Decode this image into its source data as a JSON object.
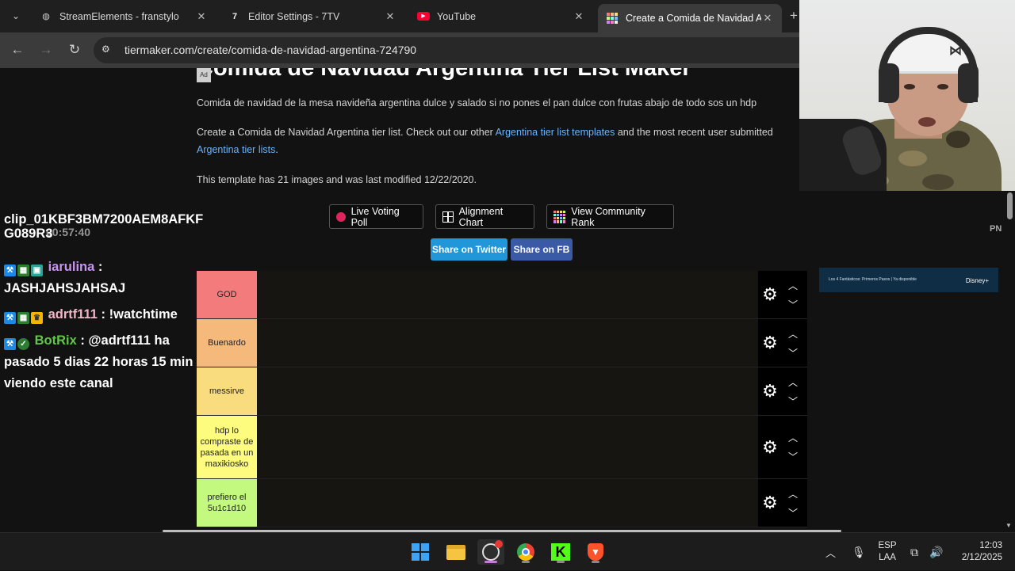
{
  "browser": {
    "tabs": [
      {
        "title": "StreamElements - franstylo",
        "icon": "streamelements-icon",
        "active": false
      },
      {
        "title": "Editor Settings - 7TV",
        "icon": "7tv-icon",
        "active": false
      },
      {
        "title": "YouTube",
        "icon": "youtube-icon",
        "active": false
      },
      {
        "title": "Create a Comida de Navidad Ar",
        "icon": "tiermaker-icon",
        "active": true
      }
    ],
    "tab_close": "✕",
    "new_tab": "+",
    "url": "tiermaker.com/create/comida-de-navidad-argentina-724790"
  },
  "page": {
    "title": "Comida de Navidad Argentina Tier List Maker",
    "ad_label": "Ad",
    "description": "Comida de navidad de la mesa navideña argentina dulce y salado si no pones el pan dulce con frutas abajo de todo sos un hdp",
    "create_text_pre": "Create a Comida de Navidad Argentina tier list. Check out our other ",
    "create_link1": "Argentina tier list templates",
    "create_text_mid": " and the most recent user submitted ",
    "create_link2": "Argentina tier lists",
    "create_text_post": ".",
    "template_info": "This template has 21 images and was last modified 12/22/2020.",
    "buttons": {
      "live_voting": "Live Voting Poll",
      "alignment_chart": "Alignment Chart",
      "community_rank": "View Community Rank",
      "share_twitter": "Share on Twitter",
      "share_fb": "Share on FB"
    },
    "tiers": [
      {
        "label": "GOD",
        "color": "#f47b7b"
      },
      {
        "label": "Buenardo",
        "color": "#f6b97c"
      },
      {
        "label": "messirve",
        "color": "#f9dc7e"
      },
      {
        "label": "hdp lo compraste de pasada en un maxikiosko",
        "color": "#fdfc7f"
      },
      {
        "label": "prefiero el 5u1c1d10",
        "color": "#c2f97e"
      }
    ]
  },
  "chat": {
    "partial_top": "clip_01KBF3BM7200AEM8AFKF",
    "partial_top2": "G089R3",
    "partial_time": "00:57:40",
    "messages": [
      {
        "user": "iarulina",
        "user_color": "#c994f0",
        "text": "JASHJAHSJAHSAJ"
      },
      {
        "user": "adrtf111",
        "user_color": "#f3b6c7",
        "text": "!watchtime"
      },
      {
        "user": "BotRix",
        "user_color": "#63c64a",
        "text": "@adrtf111 ha pasado 5 dias 22 horas 15 min viendo este canal"
      }
    ],
    "separator": " : "
  },
  "side": {
    "banner_text": "Los 4 Fantásticos: Primeros Pasos | Ya disponible",
    "banner_brand": "Disney+",
    "corner_text": "PN"
  },
  "taskbar": {
    "lang_top": "ESP",
    "lang_bottom": "LAA",
    "time": "12:03",
    "date": "2/12/2025"
  }
}
